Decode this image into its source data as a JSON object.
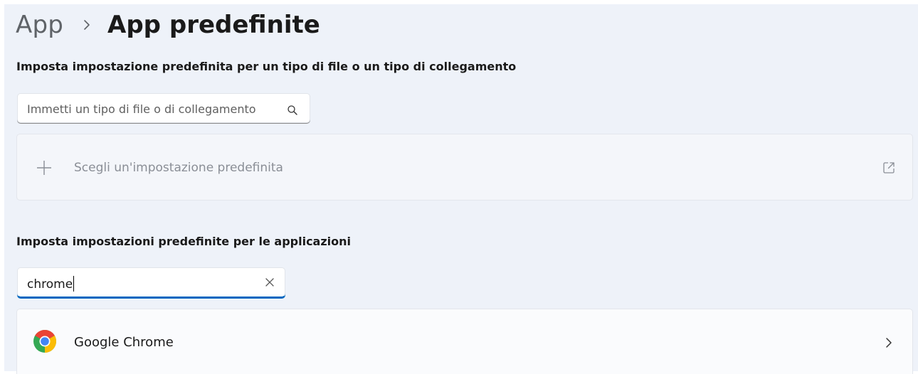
{
  "breadcrumb": {
    "parent": "App",
    "current": "App predefinite"
  },
  "file_type_section": {
    "title": "Imposta impostazione predefinita per un tipo di file o un tipo di collegamento",
    "search_placeholder": "Immetti un tipo di file o di collegamento",
    "search_icon": "search-icon",
    "choose_default_label": "Scegli un'impostazione predefinita",
    "choose_icon": "plus-icon",
    "open_icon": "open-external-icon"
  },
  "apps_section": {
    "title": "Imposta impostazioni predefinite per le applicazioni",
    "search_value": "chrome",
    "clear_icon": "close-icon",
    "results": [
      {
        "name": "Google Chrome",
        "icon": "chrome-icon"
      }
    ]
  },
  "colors": {
    "background": "#eef2f9",
    "accent": "#0067c0"
  }
}
